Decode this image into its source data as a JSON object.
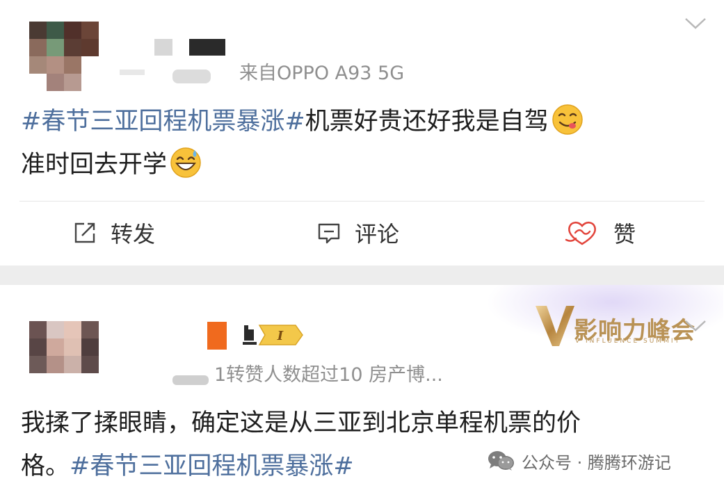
{
  "post1": {
    "meta": "来自OPPO A93 5G",
    "content_line1": [
      {
        "text": "#春节三亚回程机票暴涨#",
        "topic": true
      },
      {
        "text": "机票好贵还好我是自驾",
        "topic": false
      }
    ],
    "content_line2": "准时回去开学",
    "actions": {
      "repost": "转发",
      "comment": "评论",
      "like": "赞"
    }
  },
  "post2": {
    "meta": "1转赞人数超过10  房产博...",
    "badge": "I",
    "content_line1": "我揉了揉眼睛，确定这是从三亚到北京单程机票的价",
    "content_line2_prefix": "格。",
    "content_line2_topic": "#春节三亚回程机票暴涨#",
    "influence_title": "影响力峰会",
    "influence_subtitle": "V INFLUENCE SUMMIT"
  },
  "watermark": {
    "text": "公众号 · 腾腾环游记"
  },
  "colors": {
    "topic": "#4e6f9d",
    "like_red": "#e2453c",
    "separator": "#ededed",
    "gold": "#b99255"
  }
}
